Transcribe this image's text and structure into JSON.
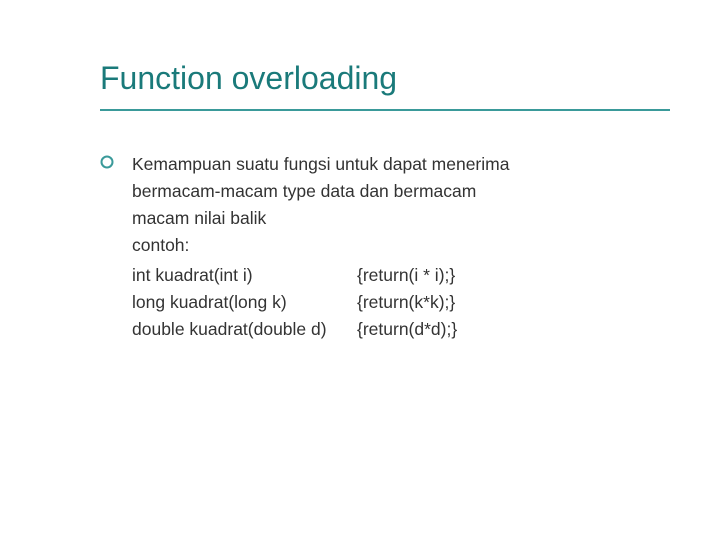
{
  "title": "Function overloading",
  "bullet": {
    "text_line1": "Kemampuan suatu fungsi untuk dapat menerima",
    "text_line2": "bermacam-macam type data dan bermacam",
    "text_line3": "macam nilai balik",
    "contoh": "contoh:",
    "code": [
      {
        "sig": "int kuadrat(int i)",
        "body": "{return(i * i);}"
      },
      {
        "sig": "long kuadrat(long k)",
        "body": "{return(k*k);}"
      },
      {
        "sig": "double kuadrat(double d)",
        "body": "{return(d*d);}"
      }
    ]
  },
  "colors": {
    "accent": "#1a7a7a",
    "underline": "#3a9a9a"
  }
}
